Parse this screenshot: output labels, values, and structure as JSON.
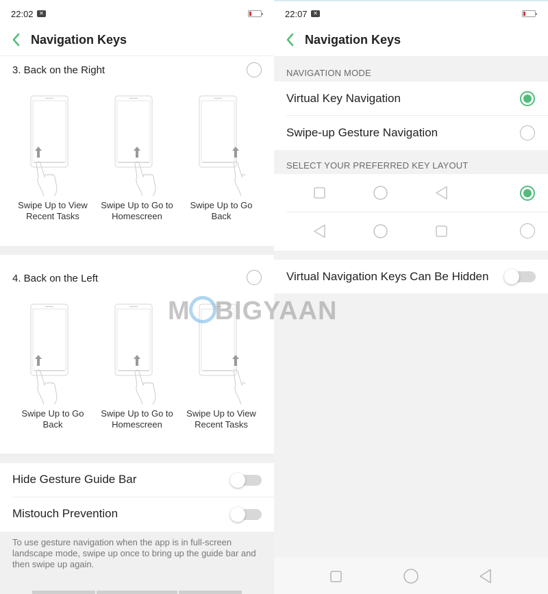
{
  "left_screen": {
    "status": {
      "time": "22:02",
      "notif_icon": "x-notification-icon",
      "battery_icon": "battery-low-icon"
    },
    "header": {
      "back_icon": "chevron-left-icon",
      "title": "Navigation Keys"
    },
    "option3": {
      "title": "3. Back on the Right",
      "selected": false,
      "illustrations": [
        {
          "caption": "Swipe Up to View Recent Tasks",
          "position": "left"
        },
        {
          "caption": "Swipe Up to Go to Homescreen",
          "position": "center"
        },
        {
          "caption": "Swipe Up to Go Back",
          "position": "right"
        }
      ]
    },
    "option4": {
      "title": "4. Back on the Left",
      "selected": false,
      "illustrations": [
        {
          "caption": "Swipe Up to Go Back",
          "position": "left"
        },
        {
          "caption": "Swipe Up to Go to Homescreen",
          "position": "center"
        },
        {
          "caption": "Swipe Up to View Recent Tasks",
          "position": "right"
        }
      ]
    },
    "toggles": [
      {
        "label": "Hide Gesture Guide Bar",
        "on": false
      },
      {
        "label": "Mistouch Prevention",
        "on": false
      }
    ],
    "note": "To use gesture navigation when the app is in full-screen landscape mode, swipe up once to bring up the guide bar and then swipe up again."
  },
  "right_screen": {
    "status": {
      "time": "22:07",
      "notif_icon": "x-notification-icon",
      "battery_icon": "battery-low-icon"
    },
    "header": {
      "back_icon": "chevron-left-icon",
      "title": "Navigation Keys"
    },
    "navigation_mode": {
      "heading": "NAVIGATION MODE",
      "options": [
        {
          "label": "Virtual Key Navigation",
          "selected": true
        },
        {
          "label": "Swipe-up Gesture Navigation",
          "selected": false
        }
      ]
    },
    "key_layout": {
      "heading": "SELECT YOUR PREFERRED KEY LAYOUT",
      "layouts": [
        {
          "keys": [
            "recents-square-icon",
            "home-circle-icon",
            "back-triangle-icon"
          ],
          "selected": true
        },
        {
          "keys": [
            "back-triangle-icon",
            "home-circle-icon",
            "recents-square-icon"
          ],
          "selected": false
        }
      ]
    },
    "hide_keys": {
      "label": "Virtual Navigation Keys Can Be Hidden",
      "on": false
    },
    "navbar": [
      "recents-square-icon",
      "home-circle-icon",
      "back-triangle-icon"
    ]
  },
  "watermark": {
    "text_pre": "M",
    "text_post": "BIGYAAN"
  },
  "colors": {
    "accent": "#53bb7b",
    "battery_low": "#d9302c",
    "background": "#f2f2f2"
  }
}
